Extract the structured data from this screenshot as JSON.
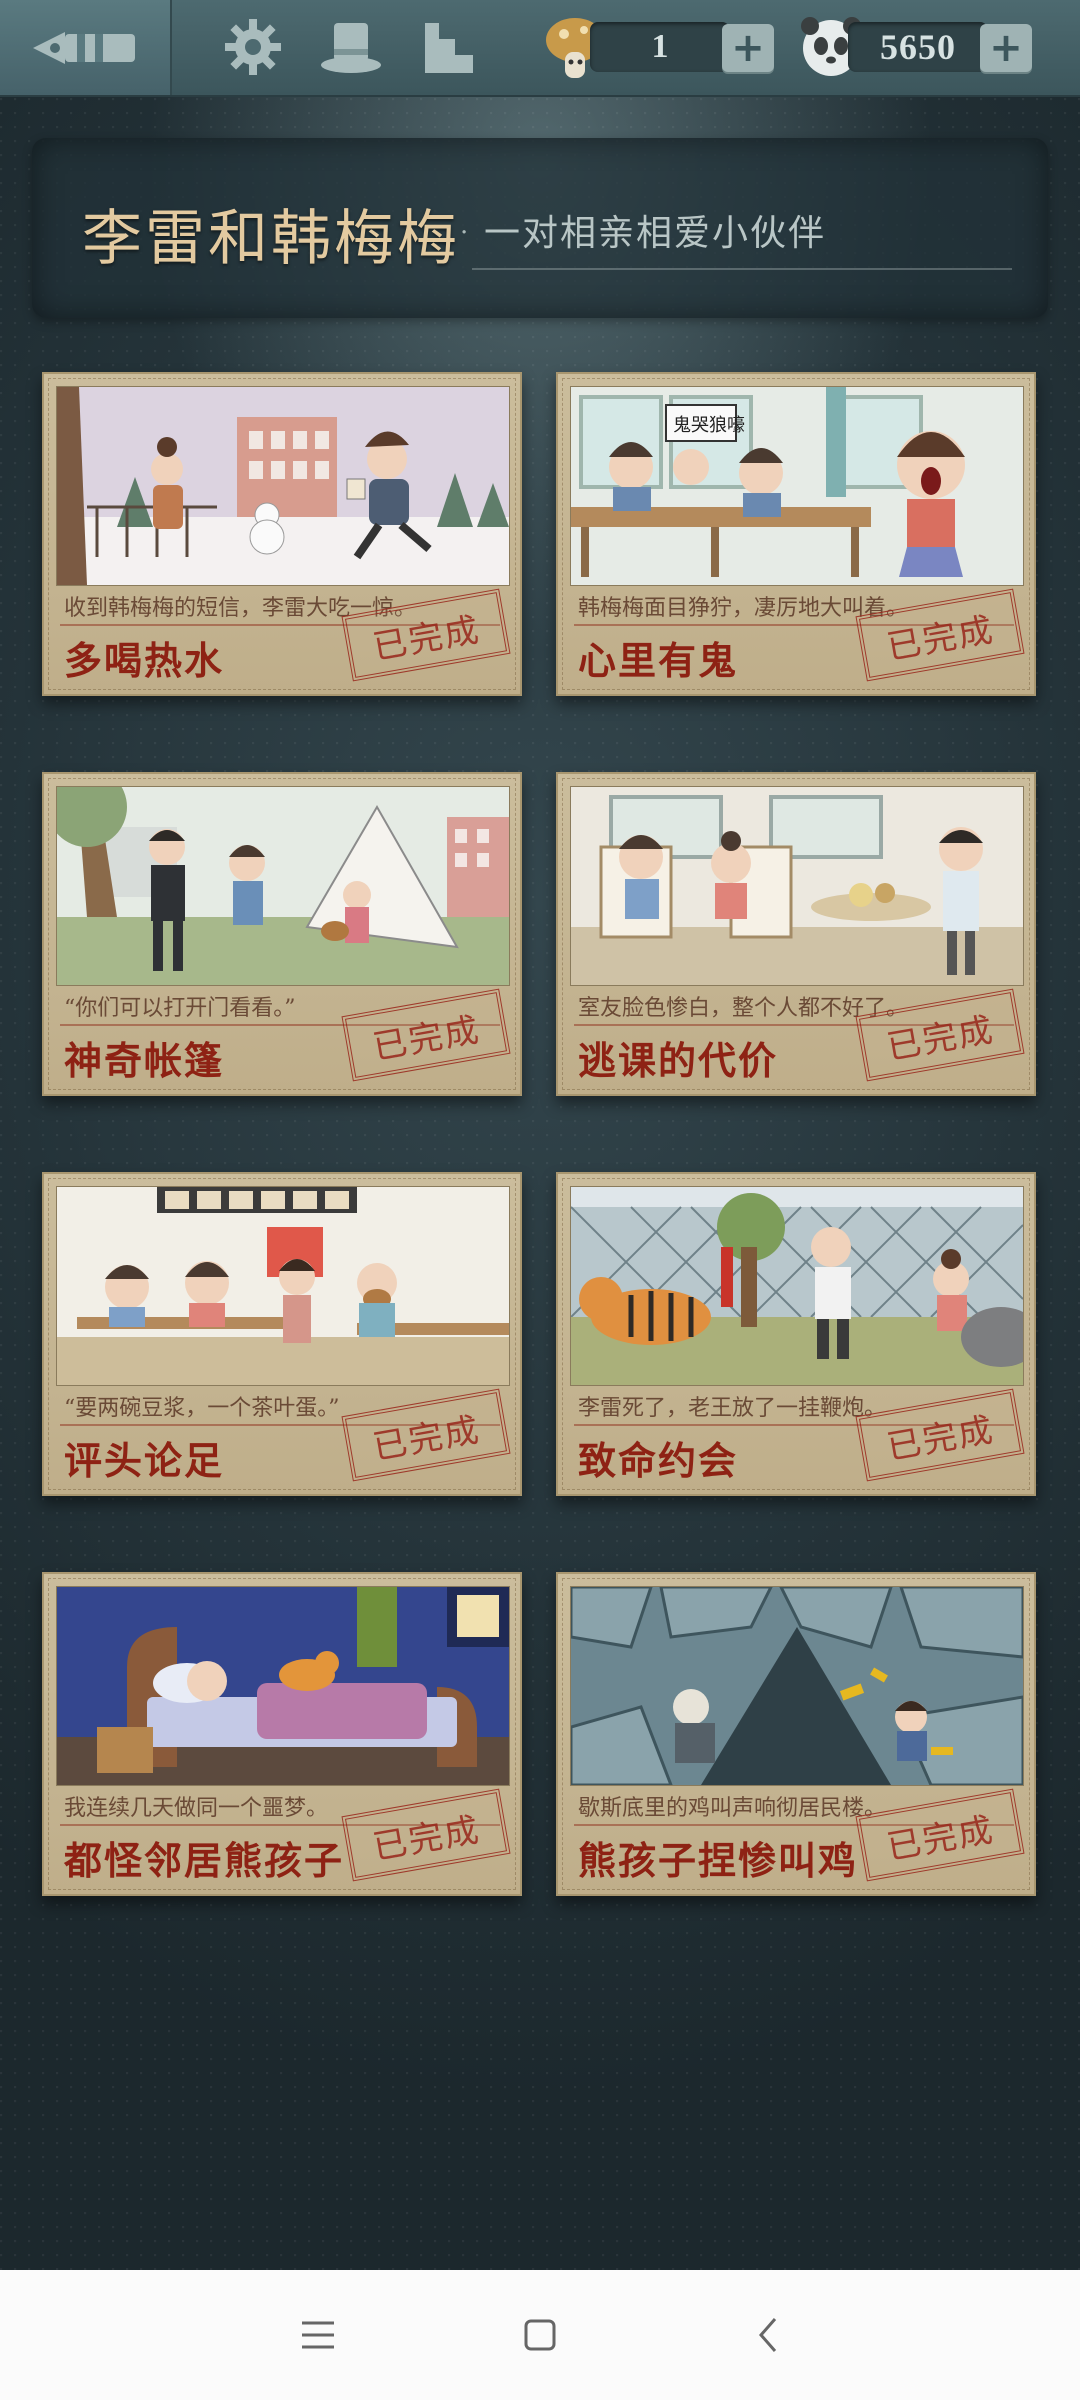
{
  "topbar": {
    "hint_count": "1",
    "coin_count": "5650",
    "icons": [
      "pen-nib-logo-icon",
      "gear-icon",
      "top-hat-icon",
      "stairs-icon",
      "mushroom-icon",
      "panda-coin-icon",
      "plus-icon"
    ]
  },
  "chapter": {
    "title": "李雷和韩梅梅",
    "subtitle": "一对相亲相爱小伙伴"
  },
  "cards": [
    {
      "name": "多喝热水",
      "desc": "收到韩梅梅的短信，李雷大吃一惊。",
      "status": "已完成"
    },
    {
      "name": "心里有鬼",
      "desc": "韩梅梅面目狰狞，凄厉地大叫着。",
      "status": "已完成",
      "sign_text": "鬼哭狼嚎"
    },
    {
      "name": "神奇帐篷",
      "desc": "“你们可以打开门看看。”",
      "status": "已完成"
    },
    {
      "name": "逃课的代价",
      "desc": "室友脸色惨白，整个人都不好了。",
      "status": "已完成"
    },
    {
      "name": "评头论足",
      "desc": "“要两碗豆浆，一个茶叶蛋。”",
      "status": "已完成"
    },
    {
      "name": "致命约会",
      "desc": "李雷死了，老王放了一挂鞭炮。",
      "status": "已完成"
    },
    {
      "name": "都怪邻居熊孩子",
      "desc": "我连续几天做同一个噩梦。",
      "status": "已完成"
    },
    {
      "name": "熊孩子捏惨叫鸡",
      "desc": "歇斯底里的鸡叫声响彻居民楼。",
      "status": "已完成"
    }
  ],
  "colors": {
    "card_paper": "#c6b692",
    "stamp_red": "#9a2a1e",
    "title_gold": "#e3caa0",
    "board_bg": "#263238"
  },
  "navbar": {
    "icons": [
      "menu-icon",
      "home-square-icon",
      "back-chevron-icon"
    ]
  }
}
